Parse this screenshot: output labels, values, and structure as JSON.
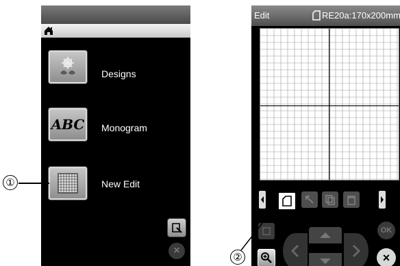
{
  "left": {
    "menu": [
      {
        "label": "Designs",
        "icon": "designs-icon"
      },
      {
        "label": "Monogram",
        "icon": "abc-monogram-icon",
        "icon_text": "ABC"
      },
      {
        "label": "New Edit",
        "icon": "grid-icon"
      }
    ],
    "home_icon": "home-icon",
    "select_icon": "select-hand-icon",
    "close_icon": "close-icon"
  },
  "right": {
    "header": {
      "title": "Edit",
      "hoop": "RE20a:170x200mm"
    },
    "tools": [
      "new-page-icon",
      "move-icon",
      "copy-icon",
      "delete-icon"
    ],
    "controls": {
      "ok_label": "OK",
      "close_label": "×"
    }
  },
  "callouts": {
    "one": "①",
    "two": "②"
  },
  "colors": {
    "screen_bg": "#000000",
    "button_gray": "#a8a8a8",
    "grid_line": "#9a9a9a"
  }
}
